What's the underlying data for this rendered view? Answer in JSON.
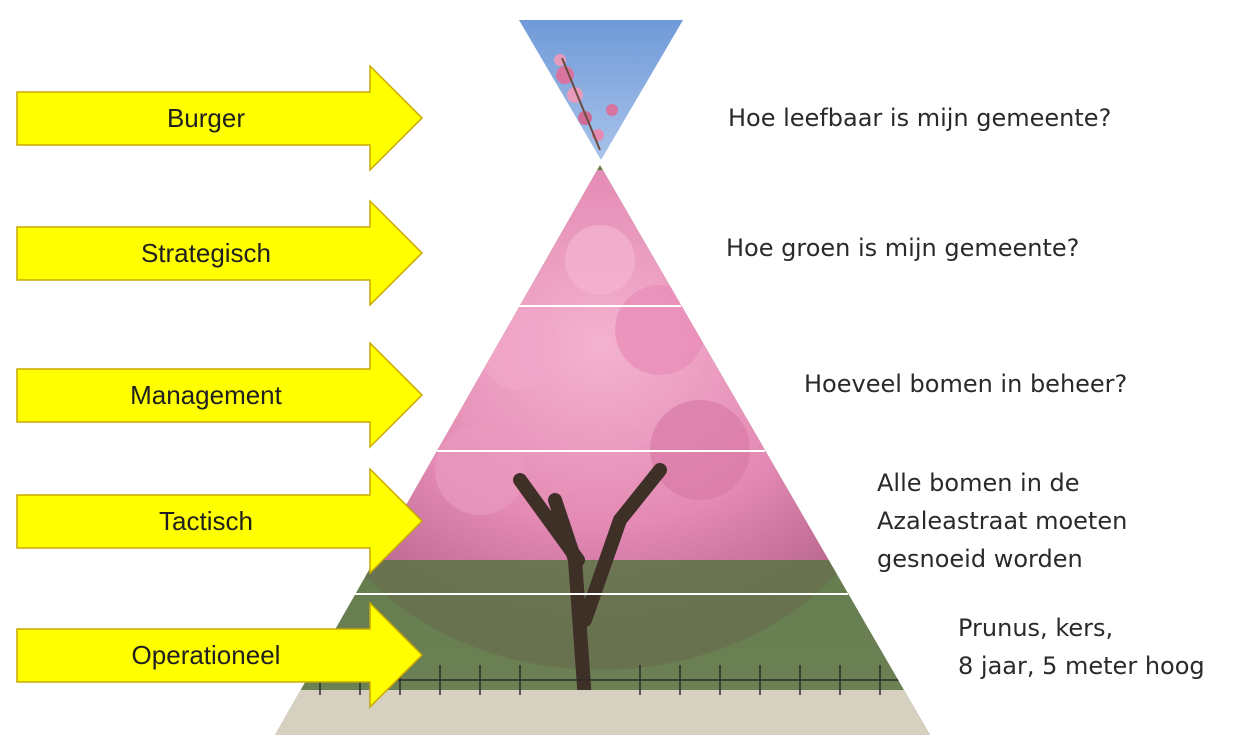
{
  "colors": {
    "arrow_fill": "#ffff00",
    "arrow_stroke": "#c9a800",
    "sky": "#7fa6dd",
    "blossom": "#e58fb7",
    "blossom_dark": "#c0648f",
    "trunk": "#4a3a30",
    "foliage": "#4f6b3a",
    "ground": "#cfc9b8"
  },
  "levels": [
    {
      "label": "Burger",
      "question": "Hoe leefbaar is mijn gemeente?"
    },
    {
      "label": "Strategisch",
      "question": "Hoe groen is mijn gemeente?"
    },
    {
      "label": "Management",
      "question": "Hoeveel bomen in beheer?"
    },
    {
      "label": "Tactisch",
      "question": "Alle bomen in de\nAzaleastraat moeten\ngesnoeid worden"
    },
    {
      "label": "Operationeel",
      "question": "Prunus, kers,\n8 jaar, 5 meter hoog"
    }
  ]
}
